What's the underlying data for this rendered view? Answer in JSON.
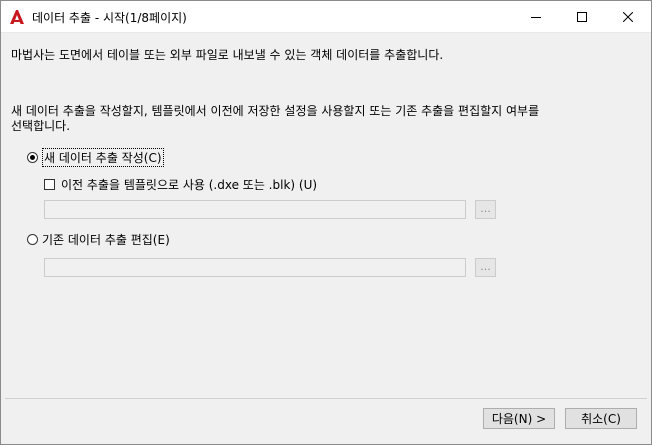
{
  "window": {
    "title": "데이터 추출 - 시작(1/8페이지)"
  },
  "intro": "마법사는 도면에서 테이블 또는 외부 파일로 내보낼 수 있는 객체 데이터를 추출합니다.",
  "description": {
    "line1": "새 데이터 추출을 작성할지, 템플릿에서 이전에 저장한 설정을 사용할지 또는 기존 추출을 편집할지 여부를",
    "line2": "선택합니다."
  },
  "options": {
    "create_new": {
      "label": "새 데이터 추출 작성(C)",
      "selected": true
    },
    "use_template": {
      "label": "이전 추출을 템플릿으로 사용 (.dxe 또는 .blk) (U)",
      "checked": false
    },
    "template_path": {
      "value": ""
    },
    "edit_existing": {
      "label": "기존 데이터 추출 편집(E)",
      "selected": false
    },
    "existing_path": {
      "value": ""
    },
    "browse_label": "..."
  },
  "buttons": {
    "next": "다음(N) >",
    "cancel": "취소(C)"
  },
  "colors": {
    "app_icon": "#c8171e",
    "dialog_bg": "#f0f0f0"
  }
}
